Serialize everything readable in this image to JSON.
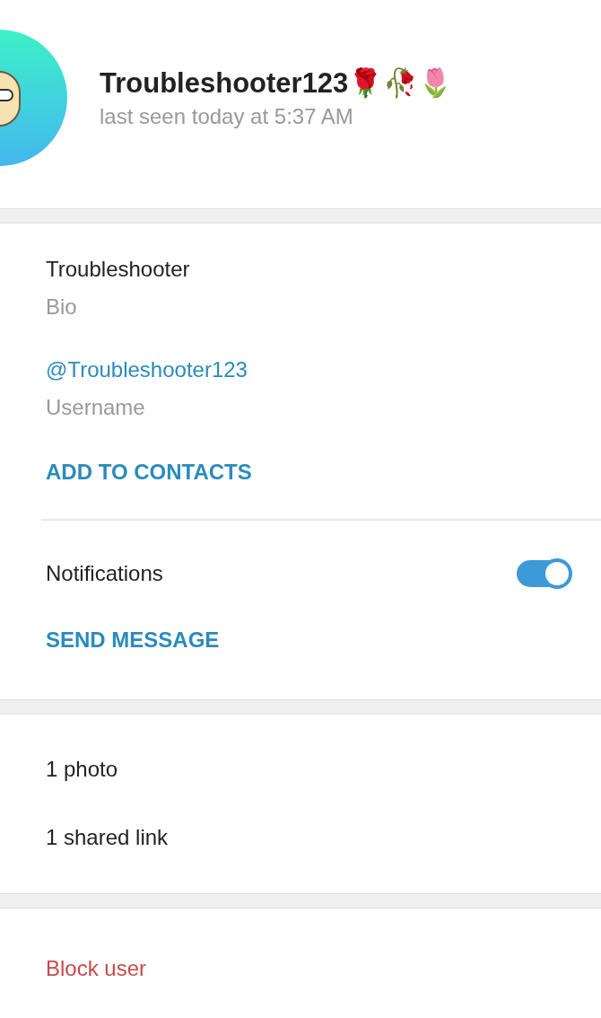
{
  "profile": {
    "name": "Troubleshooter123🌹🥀🌷",
    "status": "last seen today at 5:37 AM"
  },
  "info": {
    "bio": {
      "value": "Troubleshooter",
      "label": "Bio"
    },
    "username": {
      "value": "@Troubleshooter123",
      "label": "Username"
    },
    "add_contact": "ADD TO CONTACTS"
  },
  "notifications": {
    "label": "Notifications",
    "on": true
  },
  "send_message": "SEND MESSAGE",
  "media": [
    {
      "label": "1 photo"
    },
    {
      "label": "1 shared link"
    }
  ],
  "block": "Block user"
}
